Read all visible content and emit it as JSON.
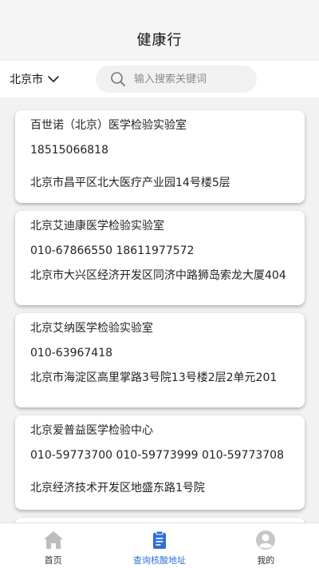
{
  "header": {
    "title": "健康行"
  },
  "search": {
    "city": "北京市",
    "placeholder": "输入搜索关键词",
    "value": ""
  },
  "labs": [
    {
      "name": "百世诺（北京）医学检验实验室",
      "phone": "18515066818",
      "address": "北京市昌平区北大医疗产业园14号楼5层"
    },
    {
      "name": "北京艾迪康医学检验实验室",
      "phone": "010-67866550 18611977572",
      "address": "北京市大兴区经济开发区同济中路狮岛索龙大厦404"
    },
    {
      "name": "北京艾纳医学检验实验室",
      "phone": "010-63967418",
      "address": "北京市海淀区高里掌路3号院13号楼2层2单元201"
    },
    {
      "name": "北京爱普益医学检验中心",
      "phone": "010-59773700 010-59773999 010-59773708",
      "address": "北京经济技术开发区地盛东路1号院"
    }
  ],
  "tabs": [
    {
      "label": "首页",
      "icon": "home-icon",
      "active": false
    },
    {
      "label": "查询核酸地址",
      "icon": "clipboard-icon",
      "active": true
    },
    {
      "label": "我的",
      "icon": "user-icon",
      "active": false
    }
  ],
  "colors": {
    "accent": "#2d6fd6",
    "tab_inactive_icon": "#bdbdbd"
  }
}
